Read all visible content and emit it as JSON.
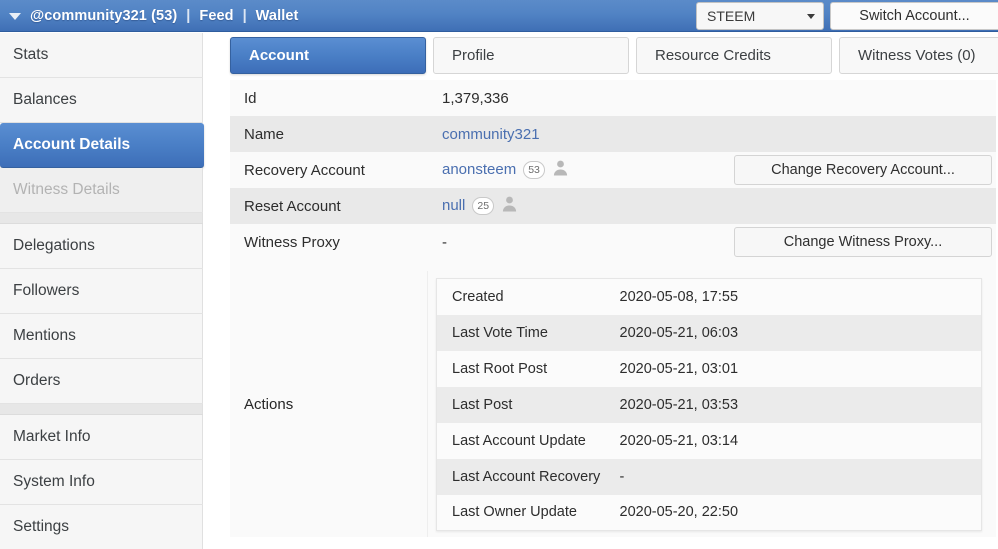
{
  "topbar": {
    "caret_icon": "caret-down-icon",
    "account_label": "@community321 (53)",
    "separator": "|",
    "feed_label": "Feed",
    "wallet_label": "Wallet",
    "chain_value": "STEEM",
    "chain_caret_icon": "chevron-down-icon",
    "switch_account_label": "Switch Account...",
    "bg_color": "#4a7fc6"
  },
  "sidebar": {
    "items": [
      {
        "label": "Stats",
        "state": "normal"
      },
      {
        "label": "Balances",
        "state": "normal"
      },
      {
        "label": "Account Details",
        "state": "active"
      },
      {
        "label": "Witness Details",
        "state": "disabled"
      },
      {
        "label": "__gap__",
        "state": "gap"
      },
      {
        "label": "Delegations",
        "state": "normal"
      },
      {
        "label": "Followers",
        "state": "normal"
      },
      {
        "label": "Mentions",
        "state": "normal"
      },
      {
        "label": "Orders",
        "state": "normal"
      },
      {
        "label": "__gap__",
        "state": "gap"
      },
      {
        "label": "Market Info",
        "state": "normal"
      },
      {
        "label": "System Info",
        "state": "normal"
      },
      {
        "label": "Settings",
        "state": "normal"
      }
    ],
    "active_color": "#4a7fc6"
  },
  "tabs": [
    {
      "label": "Account",
      "active": true
    },
    {
      "label": "Profile",
      "active": false
    },
    {
      "label": "Resource Credits",
      "active": false
    },
    {
      "label": "Witness Votes (0)",
      "active": false
    }
  ],
  "account": {
    "rows": [
      {
        "label": "Id",
        "value": "1,379,336",
        "value_kind": "text",
        "badge": null,
        "avatar": false,
        "button": null
      },
      {
        "label": "Name",
        "value": "community321",
        "value_kind": "link",
        "badge": null,
        "avatar": false,
        "button": null
      },
      {
        "label": "Recovery Account",
        "value": "anonsteem",
        "value_kind": "link",
        "badge": "53",
        "avatar": true,
        "button": "Change Recovery Account..."
      },
      {
        "label": "Reset Account",
        "value": "null",
        "value_kind": "link",
        "badge": "25",
        "avatar": true,
        "button": null
      },
      {
        "label": "Witness Proxy",
        "value": "-",
        "value_kind": "text",
        "badge": null,
        "avatar": false,
        "button": "Change Witness Proxy..."
      }
    ],
    "actions": {
      "label": "Actions",
      "rows": [
        {
          "label": "Created",
          "value": "2020-05-08, 17:55"
        },
        {
          "label": "Last Vote Time",
          "value": "2020-05-21, 06:03"
        },
        {
          "label": "Last Root Post",
          "value": "2020-05-21, 03:01"
        },
        {
          "label": "Last Post",
          "value": "2020-05-21, 03:53"
        },
        {
          "label": "Last Account Update",
          "value": "2020-05-21, 03:14"
        },
        {
          "label": "Last Account Recovery",
          "value": "-"
        },
        {
          "label": "Last Owner Update",
          "value": "2020-05-20, 22:50"
        }
      ]
    }
  }
}
